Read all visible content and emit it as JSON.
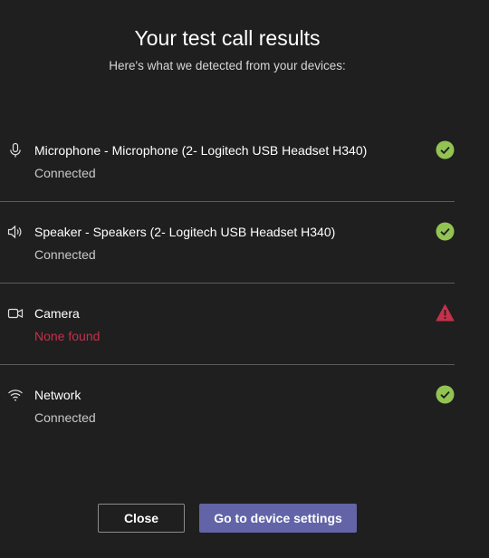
{
  "dialog": {
    "title": "Your test call results",
    "subtitle": "Here's what we detected from your devices:"
  },
  "devices": [
    {
      "icon": "microphone-icon",
      "name": "Microphone - Microphone (2- Logitech USB Headset H340)",
      "status": "Connected",
      "result": "success-check-icon"
    },
    {
      "icon": "speaker-icon",
      "name": "Speaker - Speakers (2- Logitech USB Headset H340)",
      "status": "Connected",
      "result": "success-check-icon"
    },
    {
      "icon": "camera-icon",
      "name": "Camera",
      "status": "None found",
      "result": "warning-icon"
    },
    {
      "icon": "wifi-icon",
      "name": "Network",
      "status": "Connected",
      "result": "success-check-icon"
    }
  ],
  "buttons": {
    "close_label": "Close",
    "settings_label": "Go to device settings"
  },
  "colors": {
    "background": "#1f1f1f",
    "success": "#92c353",
    "error": "#c4314b",
    "primary": "#6264a7",
    "divider": "#5a5a5a"
  }
}
